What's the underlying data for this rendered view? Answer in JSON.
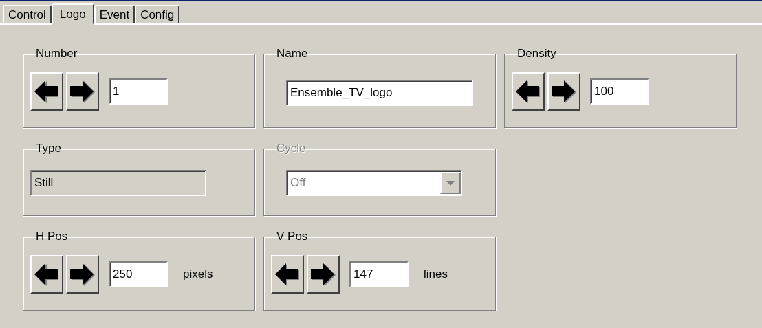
{
  "tabs": [
    {
      "label": "Control",
      "selected": false
    },
    {
      "label": "Logo",
      "selected": true
    },
    {
      "label": "Event",
      "selected": false
    },
    {
      "label": "Config",
      "selected": false
    }
  ],
  "rows": [
    [
      {
        "kind": "spinner",
        "label": "Number",
        "disabled": false,
        "value": "1"
      },
      {
        "kind": "text",
        "label": "Name",
        "disabled": false,
        "value": "Ensemble_TV_logo"
      },
      {
        "kind": "spinner",
        "label": "Density",
        "disabled": false,
        "value": "100"
      }
    ],
    [
      {
        "kind": "display",
        "label": "Type",
        "disabled": false,
        "value": "Still"
      },
      {
        "kind": "dropdown",
        "label": "Cycle",
        "disabled": true,
        "value": "Off"
      }
    ],
    [
      {
        "kind": "spinner",
        "label": "H Pos",
        "disabled": false,
        "value": "250",
        "unit": "pixels"
      },
      {
        "kind": "spinner",
        "label": "V Pos",
        "disabled": false,
        "value": "147",
        "unit": "lines"
      }
    ]
  ]
}
